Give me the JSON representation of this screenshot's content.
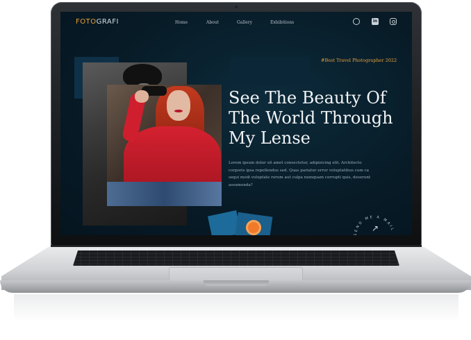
{
  "header": {
    "logo_part1": "FOTO",
    "logo_part2": "GRAFI",
    "nav": [
      "Home",
      "About",
      "Gallery",
      "Exhibitions"
    ]
  },
  "social_icons": [
    "github-icon",
    "linkedin-icon",
    "instagram-icon"
  ],
  "hero": {
    "tag": "#Best Travel Photographer 2022",
    "title_lines": [
      "See The Beauty Of",
      "The World Through",
      "My Lense"
    ],
    "description": "Lorem ipsum dolor sit amet consectetur, adipisicing elit. Architecto corporis ipsa repellendus sed. Quas pariatur error voluptatibus cum ca sequi modi voluptate rerum aut culpa numquam corrupti quis, deserunt assumenda?",
    "mail_text": "SEND ME A MAIL",
    "arrow_icon": "arrow-up-right-icon"
  },
  "colors": {
    "accent": "#e8a23c",
    "background": "#071a26",
    "title": "#f1f3f5"
  }
}
